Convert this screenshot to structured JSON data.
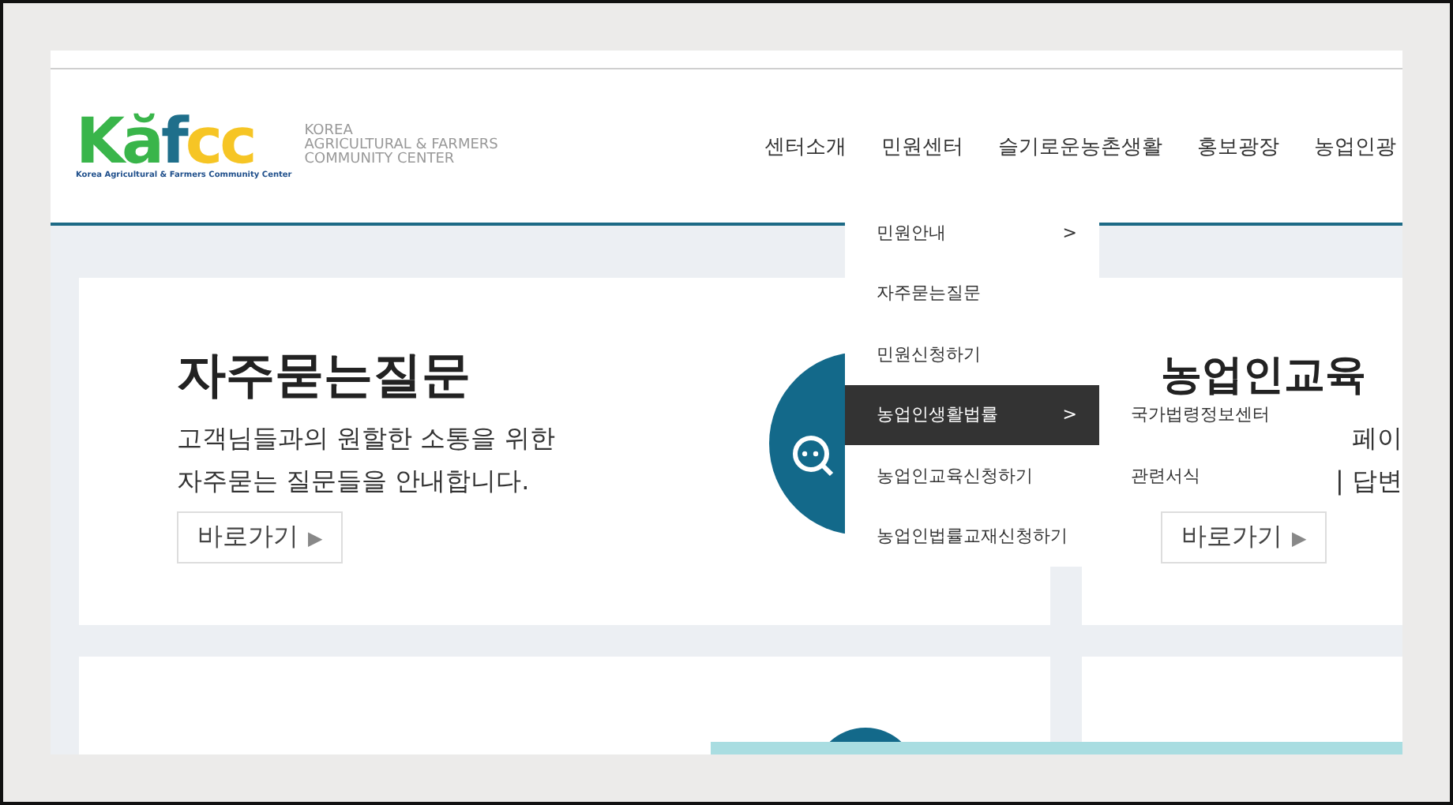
{
  "logo": {
    "mark": [
      "Kă",
      "f",
      "cc"
    ],
    "tagline": "Korea Agricultural & Farmers Community Center",
    "name_lines": [
      "KOREA",
      "AGRICULTURAL & FARMERS",
      "COMMUNITY CENTER"
    ]
  },
  "nav": [
    {
      "label": "센터소개"
    },
    {
      "label": "민원센터"
    },
    {
      "label": "슬기로운농촌생활"
    },
    {
      "label": "홍보광장"
    },
    {
      "label": "농업인광"
    }
  ],
  "dropdown": [
    {
      "label": "민원안내",
      "arrow": ">",
      "selected": false
    },
    {
      "label": "자주묻는질문",
      "selected": false
    },
    {
      "label": "민원신청하기",
      "selected": false
    },
    {
      "label": "농업인생활법률",
      "arrow": ">",
      "selected": true,
      "children": [
        {
          "label": "국가법령정보센터"
        },
        {
          "label": "관련서식"
        }
      ]
    },
    {
      "label": "농업인교육신청하기",
      "selected": false
    },
    {
      "label": "농업인법률교재신청하기",
      "selected": false
    }
  ],
  "cards": [
    {
      "title": "자주묻는질문",
      "lines": [
        "고객님들과의 원할한 소통을 위한",
        "자주묻는 질문들을 안내합니다."
      ],
      "button": "바로가기",
      "button_arrow": "▶"
    },
    {
      "title": "농업인교육",
      "lines": [
        "페이",
        "| 답변"
      ],
      "button": "바로가기",
      "button_arrow": "▶"
    }
  ]
}
